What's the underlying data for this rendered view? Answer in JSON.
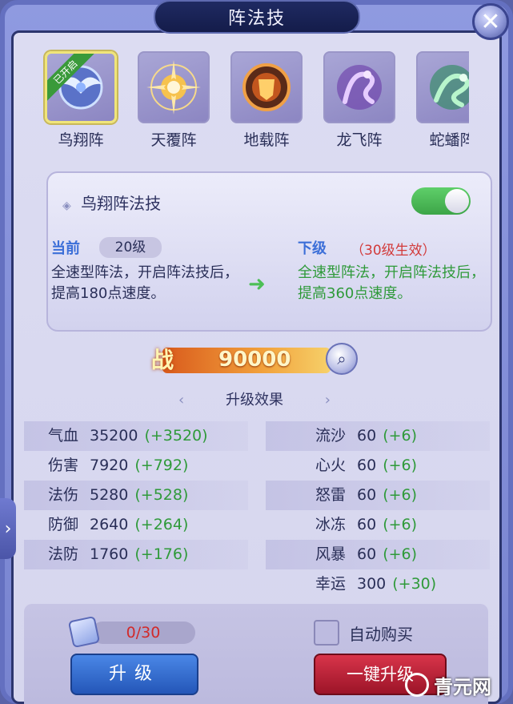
{
  "window": {
    "title": "阵法技",
    "close_glyph": "✕",
    "side_arrow_glyph": "›"
  },
  "formations": [
    {
      "label": "鸟翔阵",
      "active": true,
      "tag": "已开启",
      "icon": "bird-emblem-icon",
      "color": "#7fa6f0"
    },
    {
      "label": "天覆阵",
      "active": false,
      "icon": "sun-emblem-icon",
      "color": "#f2c14e"
    },
    {
      "label": "地载阵",
      "active": false,
      "icon": "earth-shield-icon",
      "color": "#e08a2c"
    },
    {
      "label": "龙飞阵",
      "active": false,
      "icon": "purple-dragon-icon",
      "color": "#b07ae6"
    },
    {
      "label": "蛇蟠阵",
      "active": false,
      "icon": "green-serpent-icon",
      "color": "#5cd68a"
    }
  ],
  "skill": {
    "title": "鸟翔阵法技",
    "enabled": true,
    "current_label": "当前",
    "current_level": "20级",
    "current_desc": "全速型阵法，开启阵法技后，提高180点速度。",
    "next_label": "下级",
    "next_condition": "（30级生效）",
    "next_desc": "全速型阵法，开启阵法技后，提高360点速度。"
  },
  "power": {
    "char": "战",
    "value": "90000"
  },
  "upgrade_effect": {
    "title": "升级效果",
    "left_chevron": "‹",
    "right_chevron": "›",
    "left_stats": [
      {
        "name": "气血",
        "value": "35200",
        "inc": "(+3520)"
      },
      {
        "name": "伤害",
        "value": "7920",
        "inc": "(+792)"
      },
      {
        "name": "法伤",
        "value": "5280",
        "inc": "(+528)"
      },
      {
        "name": "防御",
        "value": "2640",
        "inc": "(+264)"
      },
      {
        "name": "法防",
        "value": "1760",
        "inc": "(+176)"
      }
    ],
    "right_stats": [
      {
        "name": "流沙",
        "value": "60",
        "inc": "(+6)"
      },
      {
        "name": "心火",
        "value": "60",
        "inc": "(+6)"
      },
      {
        "name": "怒雷",
        "value": "60",
        "inc": "(+6)"
      },
      {
        "name": "冰冻",
        "value": "60",
        "inc": "(+6)"
      },
      {
        "name": "风暴",
        "value": "60",
        "inc": "(+6)"
      },
      {
        "name": "幸运",
        "value": "300",
        "inc": "(+30)"
      }
    ]
  },
  "footer": {
    "material_count": "0/30",
    "auto_buy_label": "自动购买",
    "auto_buy_checked": false,
    "upgrade_label": "升级",
    "one_click_label": "一键升级"
  },
  "watermark": {
    "text": "青元网"
  }
}
